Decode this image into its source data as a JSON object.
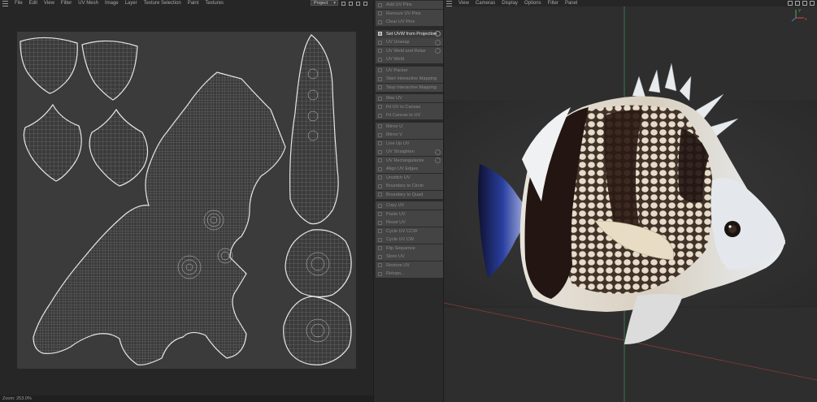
{
  "uv_editor": {
    "menu": [
      "File",
      "Edit",
      "View",
      "Filter",
      "UV Mesh",
      "Image",
      "Layer",
      "Texture Selection",
      "Paint",
      "Textures"
    ],
    "project_select": "Project",
    "status_text": "Zoom: 253.0%"
  },
  "commands": [
    {
      "label": "Add UV Pins",
      "gear": false,
      "active": false
    },
    {
      "label": "Remove UV Pins",
      "gear": false,
      "active": false
    },
    {
      "label": "Clear UV Pins",
      "gear": false,
      "active": false
    },
    {
      "label": "Set UVW from Projection",
      "gear": true,
      "active": true
    },
    {
      "label": "UV Unwrap",
      "gear": true,
      "active": false
    },
    {
      "label": "UV Weld and Relax",
      "gear": true,
      "active": false
    },
    {
      "label": "UV Weld",
      "gear": false,
      "active": false
    },
    {
      "label": "UV Packer",
      "gear": false,
      "active": false
    },
    {
      "label": "Start Interactive Mapping",
      "gear": false,
      "active": false
    },
    {
      "label": "Stop Interactive Mapping",
      "gear": false,
      "active": false
    },
    {
      "label": "Max UV",
      "gear": false,
      "active": false
    },
    {
      "label": "Fit UV to Canvas",
      "gear": false,
      "active": false
    },
    {
      "label": "Fit Canvas to UV",
      "gear": false,
      "active": false
    },
    {
      "label": "Mirror U",
      "gear": false,
      "active": false
    },
    {
      "label": "Mirror V",
      "gear": false,
      "active": false
    },
    {
      "label": "Line Up UV",
      "gear": false,
      "active": false
    },
    {
      "label": "UV Straighten",
      "gear": true,
      "active": false
    },
    {
      "label": "UV Rectangularize",
      "gear": true,
      "active": false
    },
    {
      "label": "Align UV Edges",
      "gear": false,
      "active": false
    },
    {
      "label": "Unstitch UV",
      "gear": false,
      "active": false
    },
    {
      "label": "Boundary to Circle",
      "gear": false,
      "active": false
    },
    {
      "label": "Boundary to Quad",
      "gear": false,
      "active": false
    },
    {
      "label": "Copy UV",
      "gear": false,
      "active": false
    },
    {
      "label": "Paste UV",
      "gear": false,
      "active": false
    },
    {
      "label": "Reset UV",
      "gear": false,
      "active": false
    },
    {
      "label": "Cycle UV CCW",
      "gear": false,
      "active": false
    },
    {
      "label": "Cycle UV CW",
      "gear": false,
      "active": false
    },
    {
      "label": "Flip Sequence",
      "gear": false,
      "active": false
    },
    {
      "label": "Store UV",
      "gear": false,
      "active": false
    },
    {
      "label": "Restore UV",
      "gear": false,
      "active": false
    },
    {
      "label": "Retopo...",
      "gear": false,
      "active": false
    }
  ],
  "viewport": {
    "menu": [
      "View",
      "Cameras",
      "Display",
      "Options",
      "Filter",
      "Panel"
    ],
    "axis_labels": {
      "x": "x",
      "y": "Y"
    }
  },
  "colors": {
    "uv_canvas": "#3b3b3b",
    "uv_lines": "#d9d9d9",
    "fish_fin_blue": "#2a3fa0",
    "fish_stripe": "#231612",
    "y_axis": "#3c8a55",
    "x_axis": "#8a3a3a"
  }
}
